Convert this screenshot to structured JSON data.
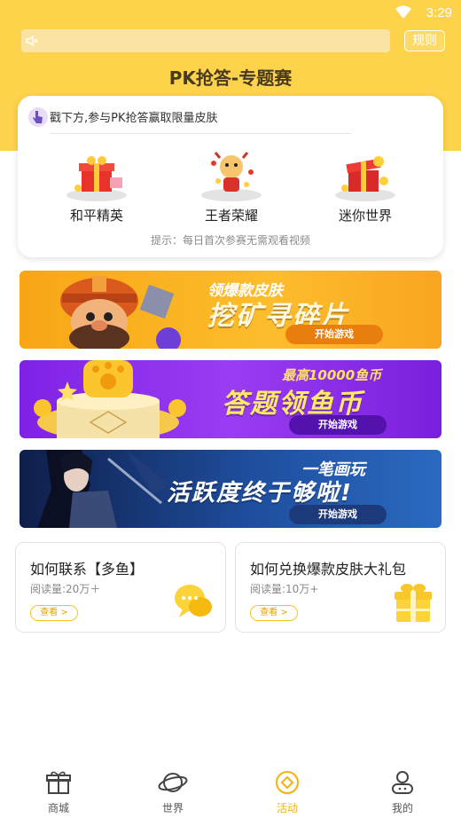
{
  "status_bar": {
    "time": "3:29"
  },
  "header": {
    "rules_label": "规则",
    "title": "PK抢答-专题赛"
  },
  "intro_card": {
    "intro_text": "戳下方,参与PK抢答赢取限量皮肤",
    "games": [
      {
        "label": "和平精英",
        "icon": "red-gift-box-icon"
      },
      {
        "label": "王者荣耀",
        "icon": "cartoon-cow-icon"
      },
      {
        "label": "迷你世界",
        "icon": "red-gift-box-icon"
      }
    ],
    "hint": "提示：每日首次参赛无需观看视频"
  },
  "banners": [
    {
      "sub": "领爆款皮肤",
      "main": "挖矿寻碎片",
      "button": "开始游戏",
      "color": "#f7a614"
    },
    {
      "sub": "最高10000鱼币",
      "main": "答题领鱼币",
      "button": "开始游戏",
      "color": "#8a2ce8"
    },
    {
      "sub": "一笔画玩",
      "main": "活跃度终于够啦!",
      "button": "开始游戏",
      "color": "#1a3d80"
    }
  ],
  "info_cards": [
    {
      "title": "如何联系【多鱼】",
      "reads": "阅读量:20万＋",
      "view": "查看 >",
      "icon": "chat-bubble-icon"
    },
    {
      "title": "如何兑换爆款皮肤大礼包",
      "reads": "阅读量:10万+",
      "view": "查看 >",
      "icon": "gift-box-icon"
    }
  ],
  "tabs": [
    {
      "label": "商城",
      "icon": "gift-icon",
      "active": false
    },
    {
      "label": "世界",
      "icon": "planet-icon",
      "active": false
    },
    {
      "label": "活动",
      "icon": "activity-icon",
      "active": true
    },
    {
      "label": "我的",
      "icon": "user-icon",
      "active": false
    }
  ],
  "colors": {
    "brand_yellow": "#fdd34c",
    "accent": "#f4b10f"
  }
}
